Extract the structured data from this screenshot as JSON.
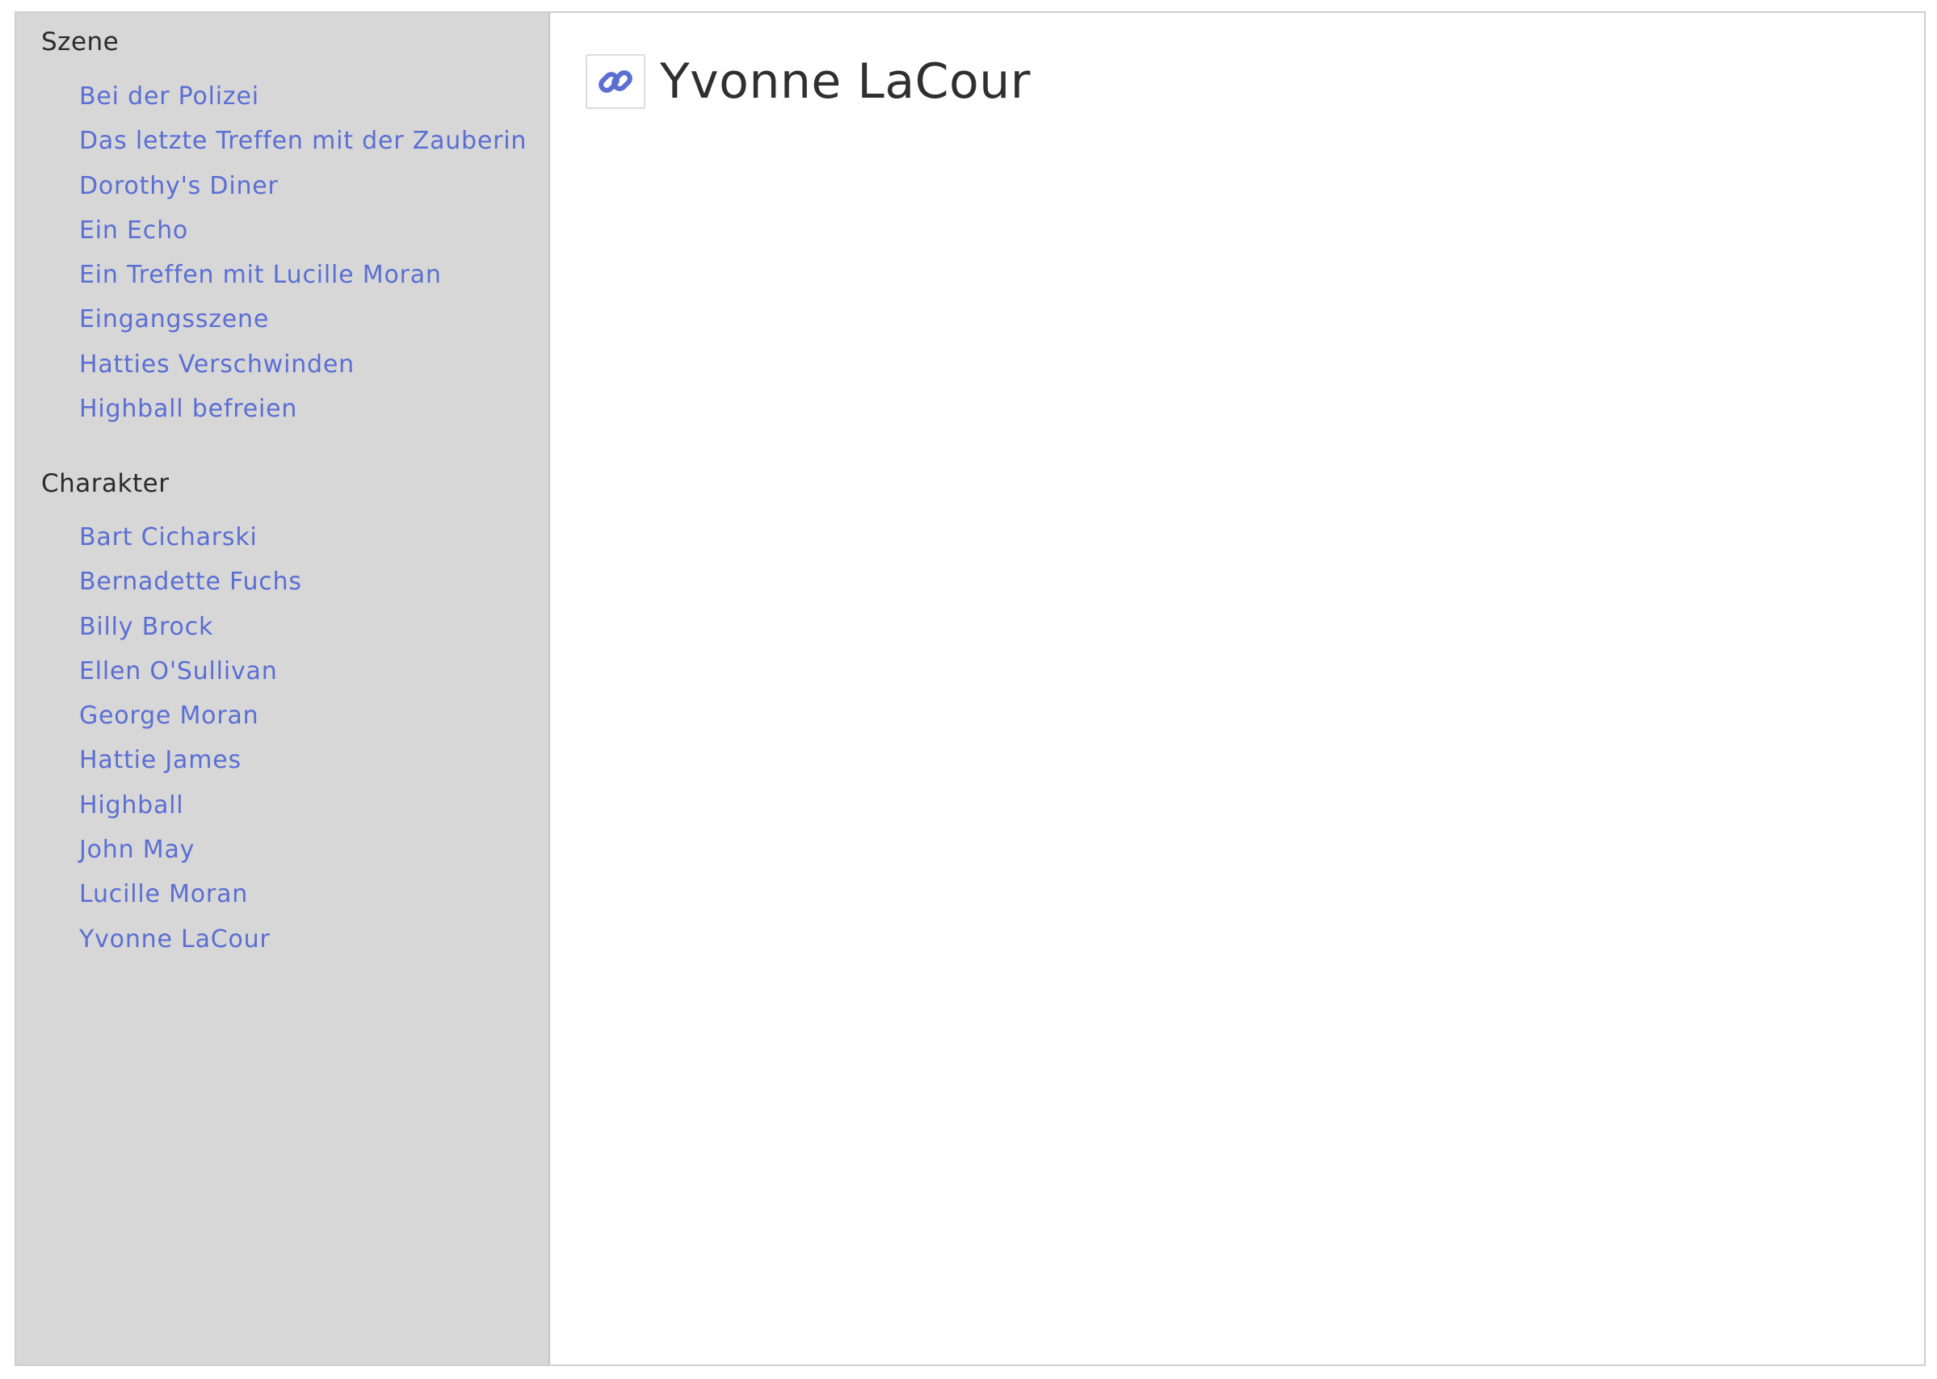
{
  "sidebar": {
    "scenes": {
      "title": "Szene",
      "items": [
        "Bei der Polizei",
        "Das letzte Treffen mit der Zauberin",
        "Dorothy's Diner",
        "Ein Echo",
        "Ein Treffen mit Lucille Moran",
        "Eingangsszene",
        "Hatties Verschwinden",
        "Highball befreien"
      ]
    },
    "characters": {
      "title": "Charakter",
      "items": [
        "Bart Cicharski",
        "Bernadette Fuchs",
        "Billy Brock",
        "Ellen O'Sullivan",
        "George Moran",
        "Hattie James",
        "Highball",
        "John May",
        "Lucille Moran",
        "Yvonne LaCour"
      ]
    }
  },
  "main": {
    "title": "Yvonne LaCour",
    "icon": "link-icon"
  },
  "colors": {
    "link": "#5b6ed2",
    "sidebar_bg": "#d7d7d8",
    "text": "#2f2f2f"
  }
}
